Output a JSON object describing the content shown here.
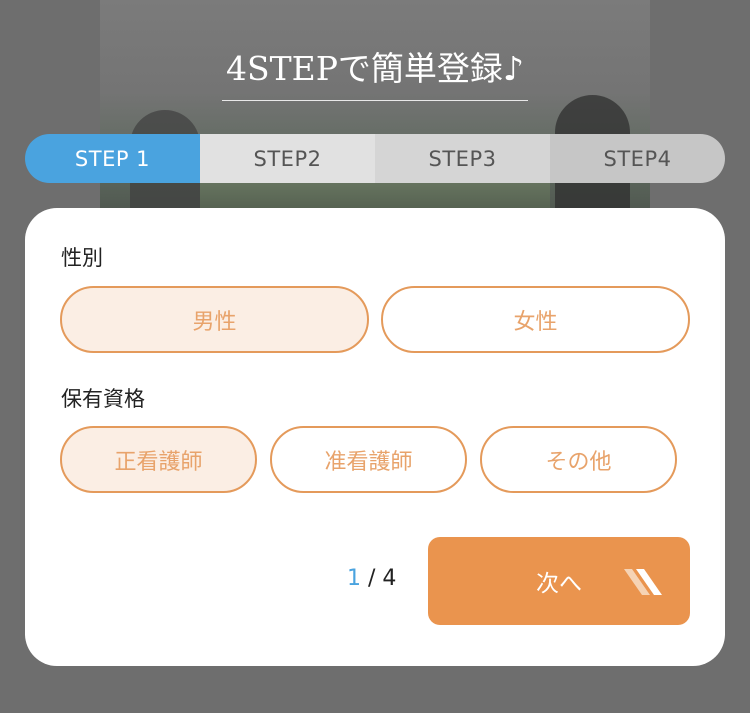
{
  "header": {
    "title": "4STEPで簡単登録♪"
  },
  "steps": [
    {
      "label": "STEP 1",
      "active": true
    },
    {
      "label": "STEP2",
      "active": false
    },
    {
      "label": "STEP3",
      "active": false
    },
    {
      "label": "STEP4",
      "active": false
    }
  ],
  "form": {
    "gender": {
      "label": "性別",
      "options": [
        "男性",
        "女性"
      ],
      "selected": "男性"
    },
    "qualification": {
      "label": "保有資格",
      "options": [
        "正看護師",
        "准看護師",
        "その他"
      ],
      "selected": "正看護師"
    }
  },
  "pager": {
    "current": "1",
    "separator": " / ",
    "total": "4"
  },
  "next_button": {
    "label": "次へ"
  },
  "colors": {
    "accent_orange": "#ea944e",
    "step_active_blue": "#4aa3df",
    "selected_fill": "#fbeee4"
  }
}
